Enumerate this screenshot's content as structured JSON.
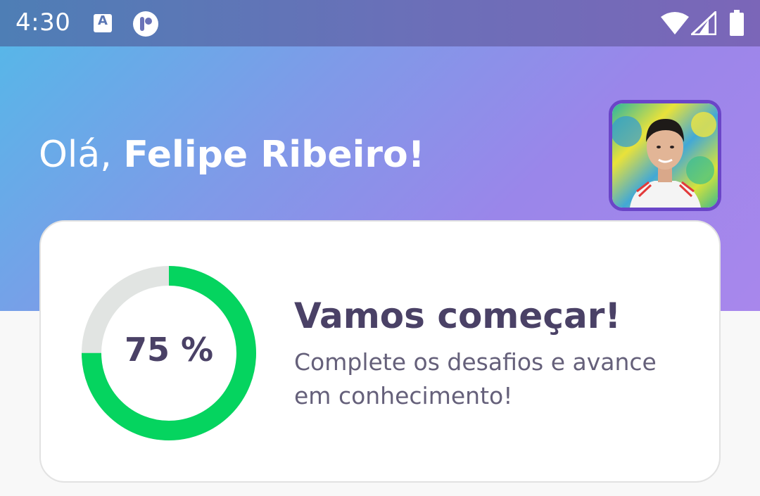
{
  "status_bar": {
    "time": "4:30",
    "icons": [
      "app-a-icon",
      "app-p-icon",
      "wifi-icon",
      "signal-icon",
      "battery-icon"
    ]
  },
  "header": {
    "greeting_prefix": "Olá, ",
    "user_name": "Felipe Ribeiro!"
  },
  "progress_card": {
    "percent_label": "75 %",
    "progress": 0.75,
    "title": "Vamos começar!",
    "description": "Complete os desafios e avance em conhecimento!"
  },
  "colors": {
    "progress_fill": "#05d45f",
    "progress_track": "#e1e4e2",
    "text_dark": "#4a4166",
    "avatar_border": "#6a45c8"
  }
}
